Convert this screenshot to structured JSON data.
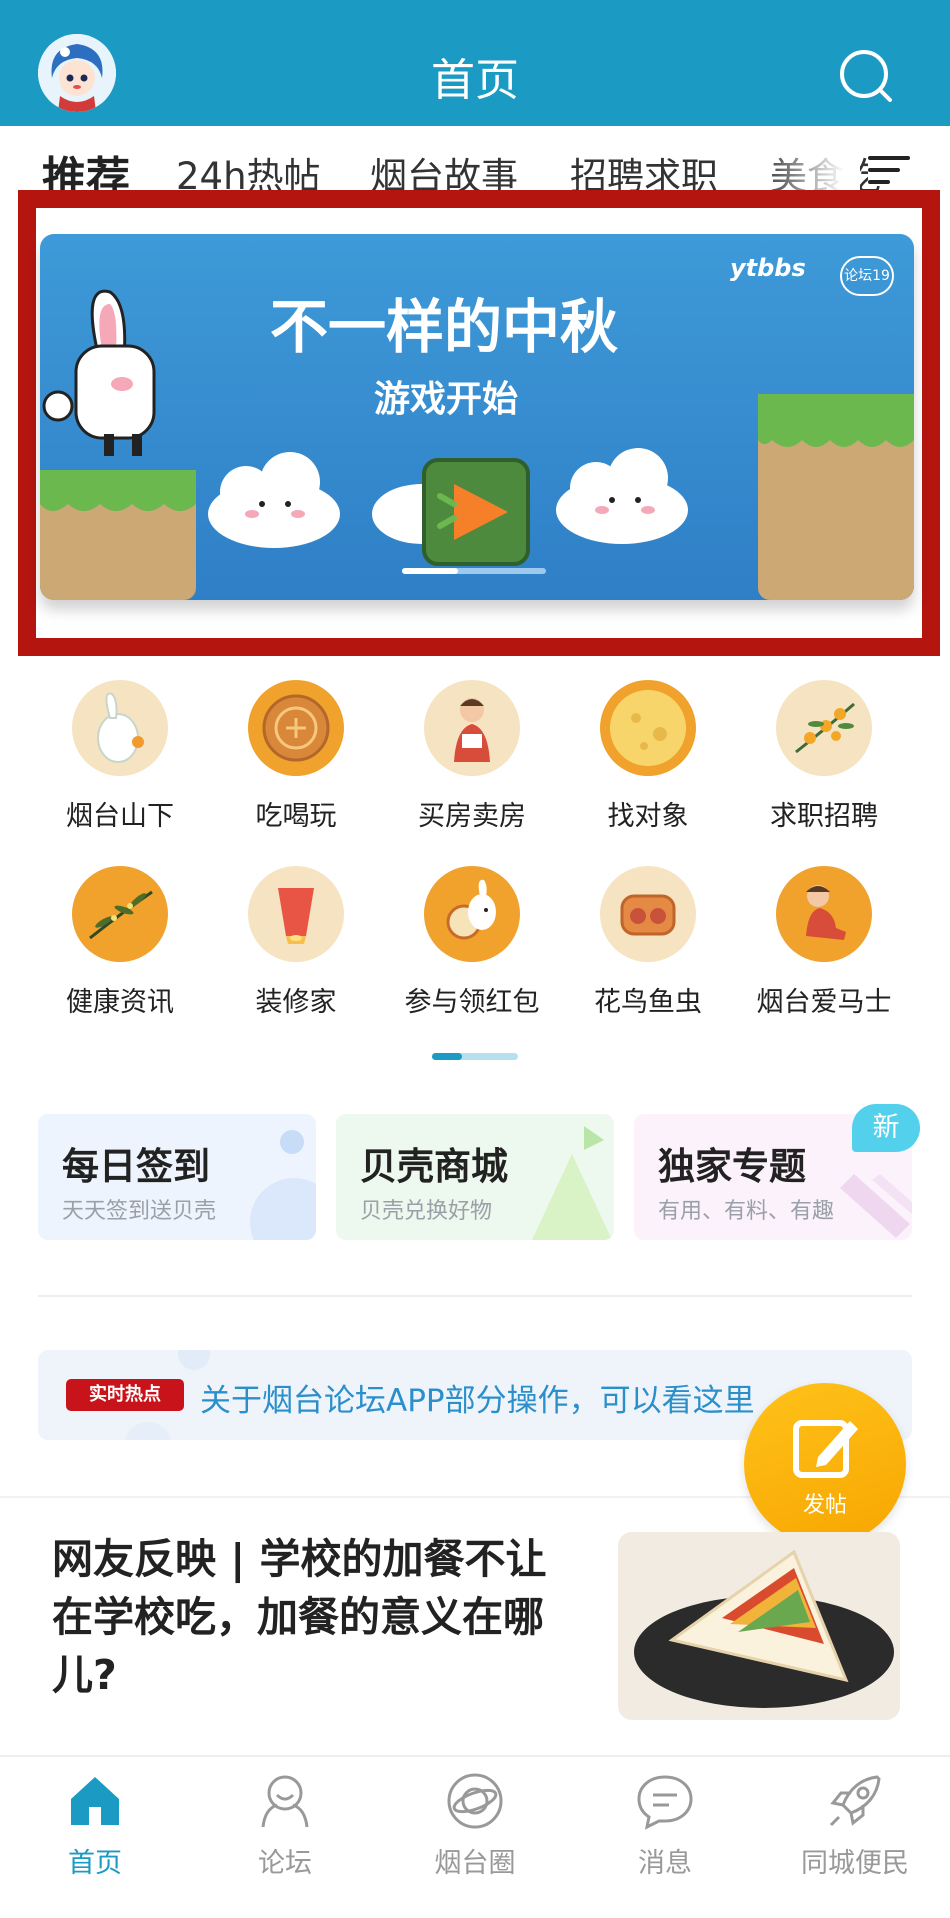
{
  "header": {
    "title": "首页"
  },
  "tabs": [
    {
      "label": "推荐"
    },
    {
      "label": "24h热帖"
    },
    {
      "label": "烟台故事"
    },
    {
      "label": "招聘求职"
    },
    {
      "label": "美食吃"
    }
  ],
  "banner": {
    "title": "不一样的中秋",
    "subtitle": "游戏开始",
    "logo": "ytbbs",
    "badge": "论坛19",
    "slide_index": 1,
    "slide_count": 3
  },
  "grid": [
    {
      "label": "烟台山下",
      "icon": "rabbit-icon"
    },
    {
      "label": "吃喝玩",
      "icon": "mooncake-icon"
    },
    {
      "label": "买房卖房",
      "icon": "boy-reading-icon"
    },
    {
      "label": "找对象",
      "icon": "moon-icon"
    },
    {
      "label": "求职招聘",
      "icon": "osmanthus-icon"
    },
    {
      "label": "健康资讯",
      "icon": "branch-icon"
    },
    {
      "label": "装修家",
      "icon": "lantern-icon"
    },
    {
      "label": "参与领红包",
      "icon": "rabbit-drum-icon"
    },
    {
      "label": "花鸟鱼虫",
      "icon": "mooncake-cut-icon"
    },
    {
      "label": "烟台爱马士",
      "icon": "child-sitting-icon"
    }
  ],
  "cards": [
    {
      "title": "每日签到",
      "subtitle": "天天签到送贝壳"
    },
    {
      "title": "贝壳商城",
      "subtitle": "贝壳兑换好物"
    },
    {
      "title": "独家专题",
      "subtitle": "有用、有料、有趣"
    }
  ],
  "new_badge": "新",
  "hot": {
    "badge": "实时热点",
    "text": "关于烟台论坛APP部分操作，可以看这里"
  },
  "fab": {
    "label": "发帖"
  },
  "article": {
    "title": "网友反映 | 学校的加餐不让在学校吃，加餐的意义在哪儿?"
  },
  "nav": [
    {
      "label": "首页",
      "icon": "home-icon"
    },
    {
      "label": "论坛",
      "icon": "forum-icon"
    },
    {
      "label": "烟台圈",
      "icon": "planet-icon"
    },
    {
      "label": "消息",
      "icon": "message-icon"
    },
    {
      "label": "同城便民",
      "icon": "rocket-icon"
    }
  ],
  "colors": {
    "primary": "#1b9ac3",
    "banner_frame": "#b5150f",
    "hot_badge": "#c8131a",
    "hot_text": "#2b8fcb",
    "fab": "#f7a600",
    "new_badge": "#53d0ec"
  }
}
